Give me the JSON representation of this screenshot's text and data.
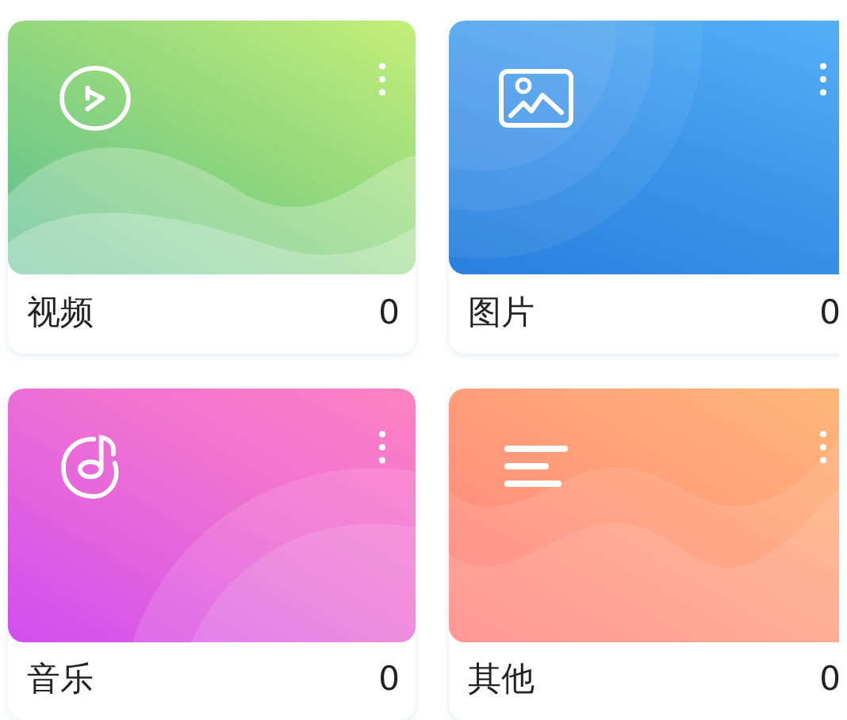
{
  "categories": [
    {
      "kind": "video",
      "label": "视频",
      "count": "0"
    },
    {
      "kind": "image",
      "label": "图片",
      "count": "0"
    },
    {
      "kind": "music",
      "label": "音乐",
      "count": "0"
    },
    {
      "kind": "other",
      "label": "其他",
      "count": "0"
    }
  ]
}
